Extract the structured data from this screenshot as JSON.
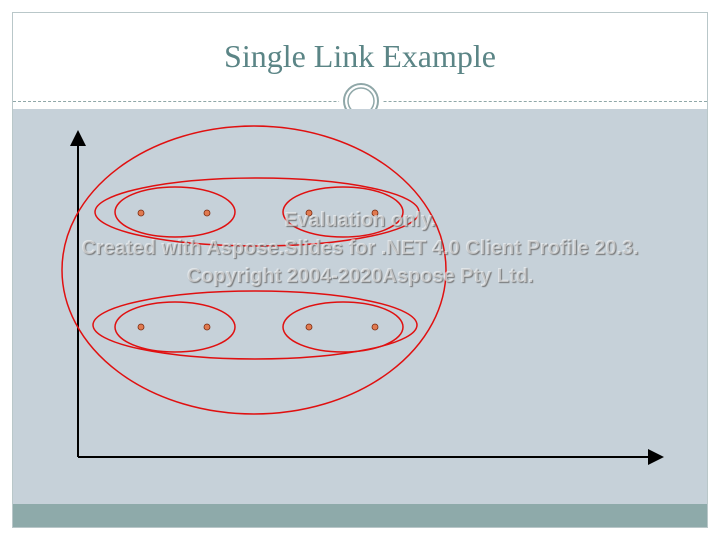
{
  "slide": {
    "title": "Single Link Example"
  },
  "watermark": {
    "line1": "Evaluation only.",
    "line2": "Created with Aspose.Slides for .NET 4.0 Client Profile 20.3.",
    "line3": "Copyright 2004-2020Aspose Pty Ltd."
  },
  "colors": {
    "title": "#5b8586",
    "content_bg": "#c6d1d9",
    "footer_band": "#8eaaaa",
    "cluster_outline": "#e01010",
    "point_fill": "#e07a50"
  },
  "diagram": {
    "axes": "x-y",
    "clusters": [
      "top-left pair",
      "top-right pair",
      "top row",
      "bottom-left pair",
      "bottom-right pair",
      "bottom row",
      "all points"
    ],
    "point_count": 8
  }
}
